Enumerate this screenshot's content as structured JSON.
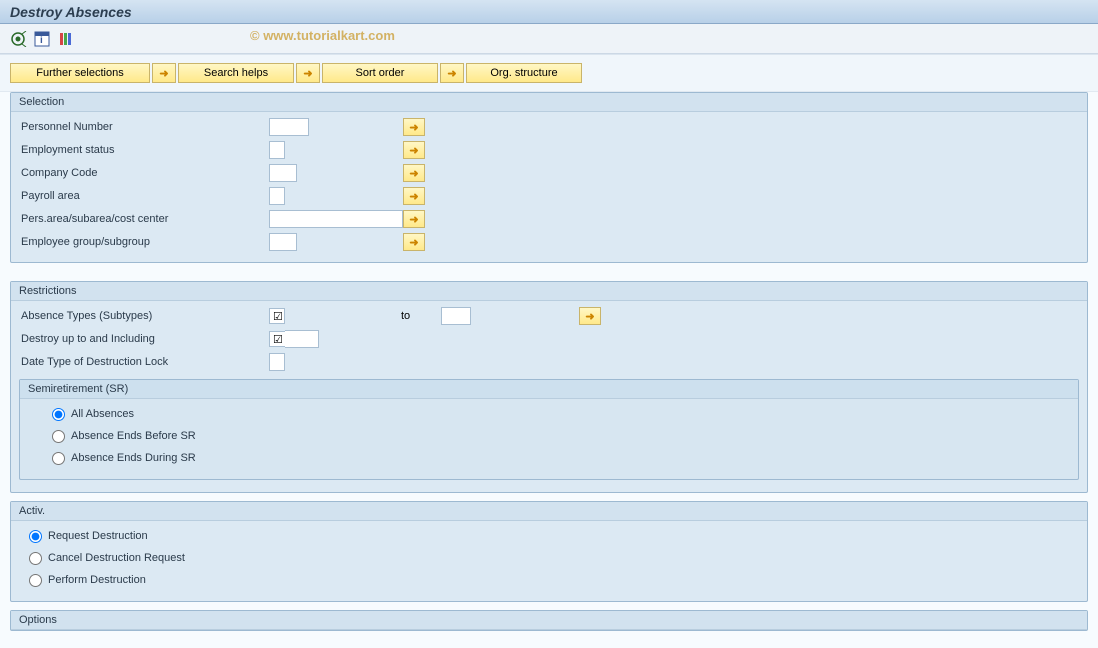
{
  "title": "Destroy Absences",
  "watermark": "© www.tutorialkart.com",
  "action_buttons": {
    "further_selections": "Further selections",
    "search_helps": "Search helps",
    "sort_order": "Sort order",
    "org_structure": "Org. structure"
  },
  "group_selection": {
    "title": "Selection",
    "fields": {
      "personnel_number": "Personnel Number",
      "employment_status": "Employment status",
      "company_code": "Company Code",
      "payroll_area": "Payroll area",
      "pers_area": "Pers.area/subarea/cost center",
      "employee_group": "Employee group/subgroup"
    }
  },
  "group_restrictions": {
    "title": "Restrictions",
    "absence_types": "Absence Types (Subtypes)",
    "to_label": "to",
    "destroy_upto": "Destroy up to and Including",
    "date_type_lock": "Date Type of Destruction Lock",
    "semiretirement": {
      "title": "Semiretirement (SR)",
      "options": {
        "all": "All Absences",
        "before": "Absence Ends Before SR",
        "during": "Absence Ends During SR"
      }
    }
  },
  "group_activ": {
    "title": "Activ.",
    "options": {
      "request": "Request Destruction",
      "cancel": "Cancel Destruction Request",
      "perform": "Perform Destruction"
    }
  },
  "group_options": {
    "title": "Options"
  },
  "checkbox_glyph": "☑"
}
